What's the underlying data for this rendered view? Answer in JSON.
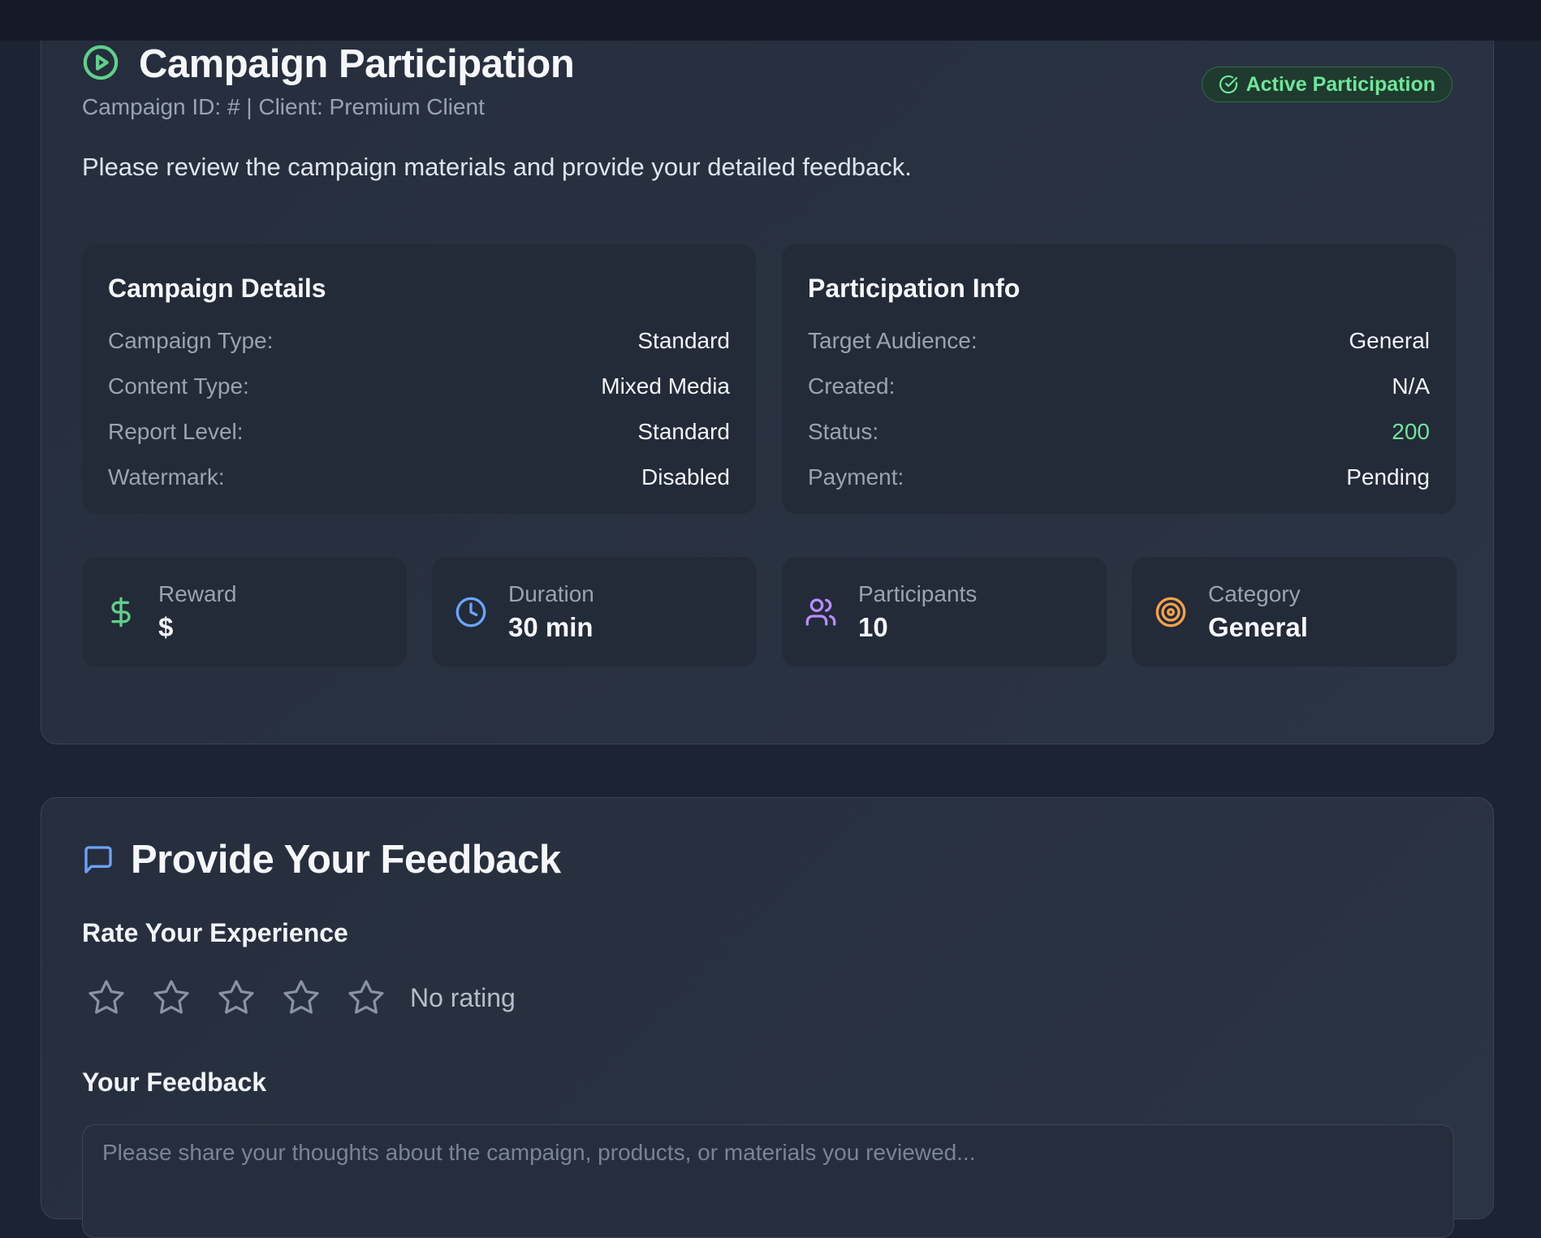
{
  "campaign": {
    "title": "Campaign Participation",
    "subtitle": "Campaign ID: # | Client: Premium Client",
    "badge": "Active Participation",
    "description": "Please review the campaign materials and provide your detailed feedback."
  },
  "details": {
    "heading": "Campaign Details",
    "rows": [
      {
        "label": "Campaign Type:",
        "value": "Standard"
      },
      {
        "label": "Content Type:",
        "value": "Mixed Media"
      },
      {
        "label": "Report Level:",
        "value": "Standard"
      },
      {
        "label": "Watermark:",
        "value": "Disabled"
      }
    ]
  },
  "participation": {
    "heading": "Participation Info",
    "rows": [
      {
        "label": "Target Audience:",
        "value": "General"
      },
      {
        "label": "Created:",
        "value": "N/A"
      },
      {
        "label": "Status:",
        "value": "200"
      },
      {
        "label": "Payment:",
        "value": "Pending"
      }
    ]
  },
  "stats": [
    {
      "label": "Reward",
      "value": "$",
      "icon": "dollar-icon",
      "color": "#5fd18a"
    },
    {
      "label": "Duration",
      "value": "30 min",
      "icon": "clock-icon",
      "color": "#6aa4ff"
    },
    {
      "label": "Participants",
      "value": "10",
      "icon": "users-icon",
      "color": "#b88cff"
    },
    {
      "label": "Category",
      "value": "General",
      "icon": "target-icon",
      "color": "#f4a24a"
    }
  ],
  "feedback": {
    "title": "Provide Your Feedback",
    "rate_label": "Rate Your Experience",
    "rating_text": "No rating",
    "rating_value": 0,
    "rating_max": 5,
    "feedback_label": "Your Feedback",
    "placeholder": "Please share your thoughts about the campaign, products, or materials you reviewed..."
  },
  "colors": {
    "accent_green": "#6ee69a",
    "accent_blue": "#6aa4ff",
    "background": "#1c2333"
  }
}
